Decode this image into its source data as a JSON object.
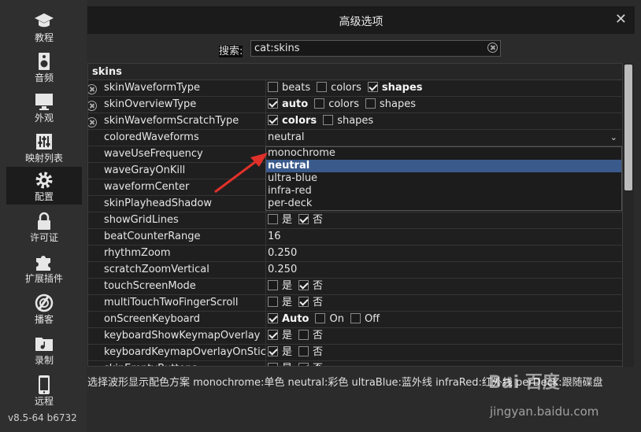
{
  "sidebar": {
    "items": [
      {
        "label": "教程",
        "icon": "graduation-cap-icon"
      },
      {
        "label": "音频",
        "icon": "speaker-icon"
      },
      {
        "label": "外观",
        "icon": "monitor-icon"
      },
      {
        "label": "映射列表",
        "icon": "sliders-icon"
      },
      {
        "label": "配置",
        "icon": "gear-icon"
      },
      {
        "label": "许可证",
        "icon": "lock-icon"
      },
      {
        "label": "扩展插件",
        "icon": "puzzle-icon"
      },
      {
        "label": "播客",
        "icon": "podcast-icon"
      },
      {
        "label": "录制",
        "icon": "folder-music-icon"
      },
      {
        "label": "远程",
        "icon": "phone-icon"
      }
    ],
    "active": "配置",
    "version": "v8.5-64 b6732"
  },
  "dialog": {
    "title": "高级选项",
    "close": "✕"
  },
  "search": {
    "label": "搜索:",
    "value": "cat:skins"
  },
  "section": "skins",
  "rows": [
    {
      "name": "skinWaveformType",
      "options": [
        {
          "label": "beats",
          "checked": false
        },
        {
          "label": "colors",
          "checked": false
        },
        {
          "label": "shapes",
          "checked": true
        }
      ],
      "clear": true
    },
    {
      "name": "skinOverviewType",
      "options": [
        {
          "label": "auto",
          "checked": true
        },
        {
          "label": "colors",
          "checked": false
        },
        {
          "label": "shapes",
          "checked": false
        }
      ],
      "clear": true
    },
    {
      "name": "skinWaveformScratchType",
      "options": [
        {
          "label": "colors",
          "checked": true
        },
        {
          "label": "shapes",
          "checked": false
        }
      ],
      "clear": true
    },
    {
      "name": "coloredWaveforms",
      "text": "neutral",
      "dropdown": true
    },
    {
      "name": "waveUseFrequency"
    },
    {
      "name": "waveGrayOnKill"
    },
    {
      "name": "waveformCenter"
    },
    {
      "name": "skinPlayheadShadow"
    },
    {
      "name": "showGridLines",
      "options": [
        {
          "label": "是",
          "checked": false
        },
        {
          "label": "否",
          "checked": true
        }
      ]
    },
    {
      "name": "beatCounterRange",
      "text": "16"
    },
    {
      "name": "rhythmZoom",
      "text": "0.250"
    },
    {
      "name": "scratchZoomVertical",
      "text": "0.250"
    },
    {
      "name": "touchScreenMode",
      "options": [
        {
          "label": "是",
          "checked": false
        },
        {
          "label": "否",
          "checked": true
        }
      ]
    },
    {
      "name": "multiTouchTwoFingerScroll",
      "options": [
        {
          "label": "是",
          "checked": false
        },
        {
          "label": "否",
          "checked": true
        }
      ]
    },
    {
      "name": "onScreenKeyboard",
      "options": [
        {
          "label": "Auto",
          "checked": true
        },
        {
          "label": "On",
          "checked": false
        },
        {
          "label": "Off",
          "checked": false
        }
      ]
    },
    {
      "name": "keyboardShowKeymapOverlay",
      "options": [
        {
          "label": "是",
          "checked": true
        },
        {
          "label": "否",
          "checked": false
        }
      ]
    },
    {
      "name": "keyboardKeymapOverlayOnStic",
      "options": [
        {
          "label": "是",
          "checked": true
        },
        {
          "label": "否",
          "checked": false
        }
      ]
    },
    {
      "name": "skinEmptyButtons",
      "options": [
        {
          "label": "是",
          "checked": false
        },
        {
          "label": "否",
          "checked": true
        }
      ]
    }
  ],
  "dropdown_options": [
    "monochrome",
    "neutral",
    "ultra-blue",
    "infra-red",
    "per-deck"
  ],
  "dropdown_selected": "neutral",
  "description": "选择波形显示配色方案  monochrome:单色  neutral:彩色  ultraBlue:蓝外线  infraRed:红外线  perDeck:跟随碟盘",
  "watermark": {
    "brand": "Bai 百度",
    "site": "jingyan.baidu.com"
  },
  "colors": {
    "selected": "#3a5a8c",
    "arrow": "#e0302a"
  }
}
